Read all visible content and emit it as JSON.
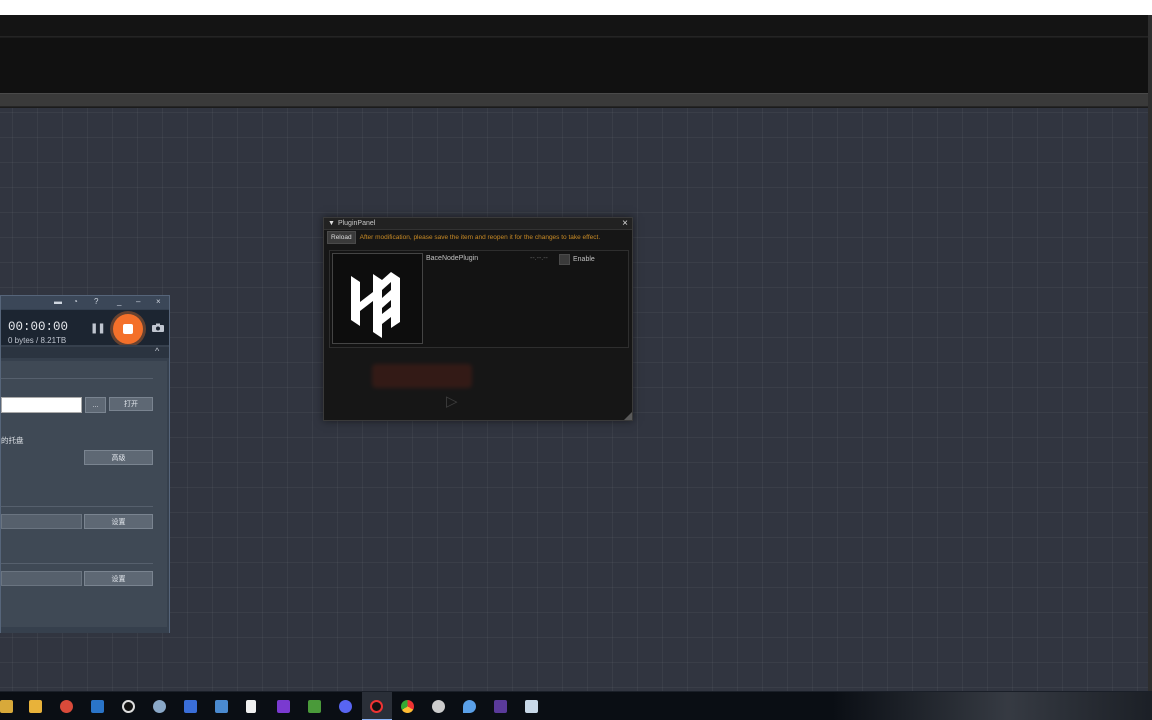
{
  "plugin_panel": {
    "title": "PluginPanel",
    "reload_label": "Reload",
    "warning": "After modification, please save the item and reopen it for the changes to take effect.",
    "plugin": {
      "name": "BaceNodePlugin",
      "version": "--.--.--",
      "enable_label": "Enable",
      "enabled": false
    }
  },
  "recorder": {
    "time": "00:00:00",
    "size": "0 bytes / 8.21TB",
    "browse_label": "...",
    "open_label": "打开",
    "tray_text": "的托盘",
    "advanced_label": "高级",
    "settings_label_1": "设置",
    "settings_label_2": "设置",
    "path_value": ""
  },
  "taskbar": {
    "icons": [
      "explorer-icon",
      "calculator-icon",
      "app-icon",
      "mail-icon",
      "record-icon",
      "paint-icon",
      "user-icon",
      "sheet-icon",
      "notepad-icon",
      "visual-studio-icon",
      "minecraft-icon",
      "discord-icon",
      "recorder-icon",
      "chrome-icon",
      "game-icon",
      "drop-icon",
      "terminal-icon",
      "window-icon"
    ]
  }
}
